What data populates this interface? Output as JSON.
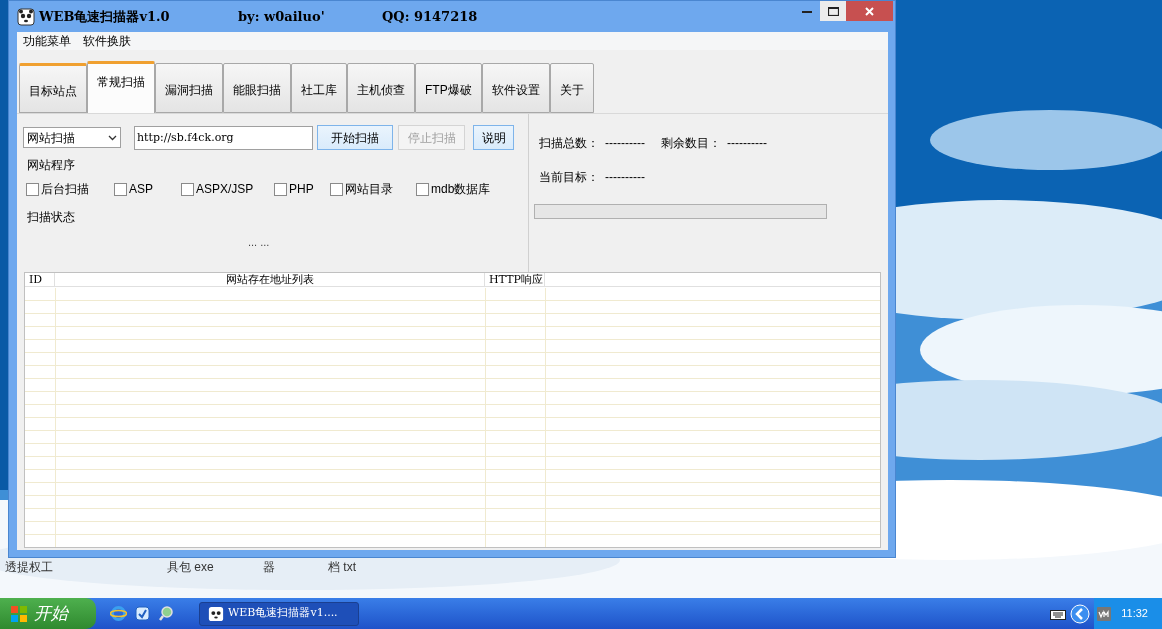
{
  "window": {
    "title": "WEB龟速扫描器v1.0",
    "author": "by: w0ailuo'",
    "qq": "QQ: 9147218"
  },
  "menu": [
    "功能菜单",
    "软件换肤"
  ],
  "tabs": [
    {
      "label": "目标站点",
      "selected": false,
      "highlighted": true
    },
    {
      "label": "常规扫描",
      "selected": true,
      "highlighted": false
    },
    {
      "label": "漏洞扫描",
      "selected": false,
      "highlighted": false
    },
    {
      "label": "能眼扫描",
      "selected": false,
      "highlighted": false
    },
    {
      "label": "社工库",
      "selected": false,
      "highlighted": false
    },
    {
      "label": "主机侦查",
      "selected": false,
      "highlighted": false
    },
    {
      "label": "FTP爆破",
      "selected": false,
      "highlighted": false
    },
    {
      "label": "软件设置",
      "selected": false,
      "highlighted": false
    },
    {
      "label": "关于",
      "selected": false,
      "highlighted": false
    }
  ],
  "scan": {
    "mode": "网站扫描",
    "url": "http://sb.f4ck.org",
    "buttons": [
      {
        "label": "开始扫描",
        "disabled": false
      },
      {
        "label": "停止扫描",
        "disabled": true
      },
      {
        "label": "说明",
        "disabled": false
      }
    ],
    "program_group": "网站程序",
    "checkboxes": [
      {
        "label": "后台扫描",
        "checked": false
      },
      {
        "label": "ASP",
        "checked": false
      },
      {
        "label": "ASPX/JSP",
        "checked": false
      },
      {
        "label": "PHP",
        "checked": false
      },
      {
        "label": "网站目录",
        "checked": false
      },
      {
        "label": "mdb数据库",
        "checked": false
      }
    ],
    "status_group": "扫描状态",
    "status_text": "... ..."
  },
  "stat_rows": [
    {
      "items": [
        {
          "label": "扫描总数：",
          "value": "----------"
        },
        {
          "label": "剩余数目：",
          "value": "----------"
        }
      ]
    },
    {
      "items": [
        {
          "label": "当前目标：",
          "value": "----------"
        }
      ]
    }
  ],
  "progress": {
    "level": 0
  },
  "table": {
    "columns": [
      "ID",
      "网站存在地址列表",
      "HTTP响应"
    ]
  },
  "desktop_labels": [
    "透提权工",
    "具包 exe",
    "器",
    "档 txt"
  ],
  "taskbar": {
    "start": "开始",
    "task": "WEB龟速扫描器v1....",
    "clock": "11:32"
  }
}
